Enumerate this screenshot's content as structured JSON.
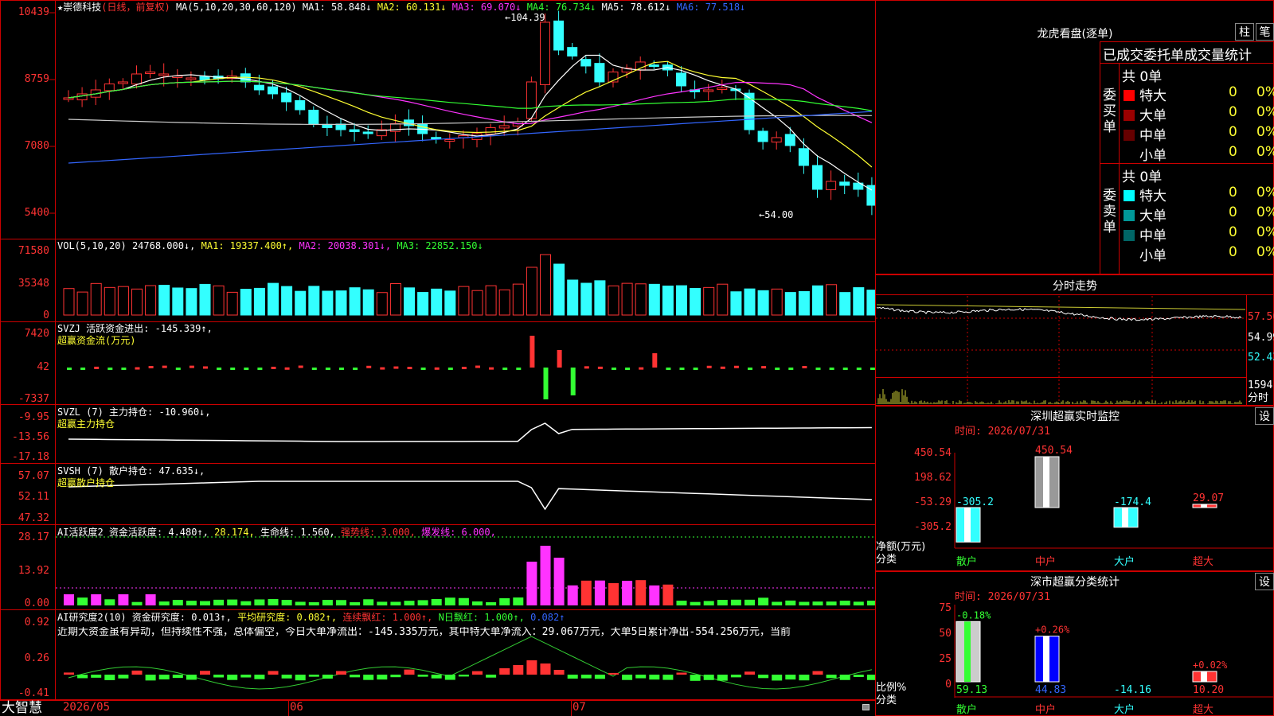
{
  "main": {
    "stock_name": "崇德科技",
    "mode": "(日线，前复权)",
    "ma_label": "MA(5,10,20,30,60,120)",
    "ma1": "MA1: 58.848↓",
    "ma2": "MA2: 60.131↓",
    "ma3": "MA3: 69.070↓",
    "ma4": "MA4: 76.734↓",
    "ma5": "MA5: 78.612↓",
    "ma6": "MA6: 77.518↓",
    "y_ticks": [
      "10439",
      "8759",
      "7080",
      "5400"
    ],
    "high_label": "←104.39",
    "low_label": "←54.00",
    "colors": {
      "ma1": "#ffffff",
      "ma2": "#ffff33",
      "ma3": "#ff33ff",
      "ma4": "#33ff33",
      "ma5": "#cccccc",
      "ma6": "#3366ff"
    }
  },
  "vol": {
    "label": "VOL(5,10,20)",
    "value": "24768.000↓,",
    "ma1": "MA1: 19337.400↑,",
    "ma2": "MA2: 20038.301↓,",
    "ma3": "MA3: 22852.150↓",
    "y_ticks": [
      "71580",
      "35348",
      "0"
    ]
  },
  "svzj": {
    "label": "SVZJ",
    "value": "活跃资金进出: -145.339↑,",
    "sub": "超赢资金流(万元)",
    "y_ticks": [
      "7420",
      "42",
      "-7337"
    ]
  },
  "svzl": {
    "label": "SVZL (7) 主力持仓: -10.960↓,",
    "sub": "超赢主力持仓",
    "y_ticks": [
      "-9.95",
      "-13.56",
      "-17.18"
    ]
  },
  "svsh": {
    "label": "SVSH (7) 散户持仓: 47.635↓,",
    "sub": "超赢散户持仓",
    "y_ticks": [
      "57.07",
      "52.11",
      "47.32"
    ]
  },
  "ai1": {
    "label": "AI活跃度2 资金活跃度: 4.480↑,",
    "v2": "28.174,",
    "v3": "生命线: 1.560,",
    "v4": "强势线: 3.000,",
    "v5": "爆发线: 6.000,",
    "y_ticks": [
      "28.17",
      "13.92",
      "0.00"
    ]
  },
  "ai2": {
    "label": "AI研究度2(10) 资金研究度: 0.013↑,",
    "v2": "平均研究度: 0.082↑,",
    "v3": "连续飘红: 1.000↑,",
    "v4": "N日飘红: 1.000↑,",
    "v5": "0.082↑",
    "text": "近期大资金虽有异动，但持续性不强，总体偏空，今日大单净流出：-145.335万元，其中特大单净流入：29.067万元，大单5日累计净出-554.256万元，当前",
    "y_ticks": [
      "0.92",
      "0.26",
      "-0.41"
    ]
  },
  "dates": {
    "brand": "大智慧",
    "d1": "2026/05",
    "d2": "06",
    "d3": "07"
  },
  "lhb": {
    "title": "龙虎看盘(逐单)",
    "btn1": "柱",
    "btn2": "笔",
    "sub": "已成交委托单成交量统计",
    "buy_label": "委买单",
    "sell_label": "委卖单",
    "buy_total": "共 0单",
    "sell_total": "共 0单",
    "buy_rows": [
      {
        "name": "特大",
        "n": "0",
        "p": "0%",
        "color": "#ff0000"
      },
      {
        "name": "大单",
        "n": "0",
        "p": "0%",
        "color": "#990000"
      },
      {
        "name": "中单",
        "n": "0",
        "p": "0%",
        "color": "#660000"
      },
      {
        "name": "小单",
        "n": "0",
        "p": "0%",
        "color": ""
      }
    ],
    "sell_rows": [
      {
        "name": "特大",
        "n": "0",
        "p": "0%",
        "color": "#00ffff"
      },
      {
        "name": "大单",
        "n": "0",
        "p": "0%",
        "color": "#009999"
      },
      {
        "name": "中单",
        "n": "0",
        "p": "0%",
        "color": "#006666"
      },
      {
        "name": "小单",
        "n": "0",
        "p": "0%",
        "color": ""
      }
    ]
  },
  "intraday": {
    "title": "分时走势",
    "y1": "57.56",
    "y2": "54.99",
    "y3": "52.43",
    "vol": "1594",
    "vol_label": "分时"
  },
  "szmon": {
    "title": "深圳超赢实时监控",
    "set": "设",
    "time": "时间: 2026/07/31",
    "y_ticks": [
      "450.54",
      "198.62",
      "-53.29",
      "-305.2"
    ],
    "ylabel": "净额(万元)",
    "xlabel": "分类",
    "cats": [
      "散户",
      "中户",
      "大户",
      "超大"
    ],
    "values": [
      -305.2,
      450.54,
      -174.4,
      29.07
    ],
    "value_labels": [
      "-305.2",
      "450.54",
      "-174.4",
      "29.07"
    ]
  },
  "szcls": {
    "title": "深市超赢分类统计",
    "set": "设",
    "time": "时间: 2026/07/31",
    "y_ticks": [
      "75",
      "50",
      "25",
      "0"
    ],
    "ylabel": "比例%",
    "xlabel": "分类",
    "cats": [
      "散户",
      "中户",
      "大户",
      "超大"
    ],
    "values": [
      59.13,
      44.83,
      -14.16,
      10.2
    ],
    "value_labels": [
      "59.13",
      "44.83",
      "-14.16",
      "10.20"
    ],
    "change_labels": [
      "-0.18%",
      "+0.26%",
      "",
      "+0.02%"
    ]
  }
}
